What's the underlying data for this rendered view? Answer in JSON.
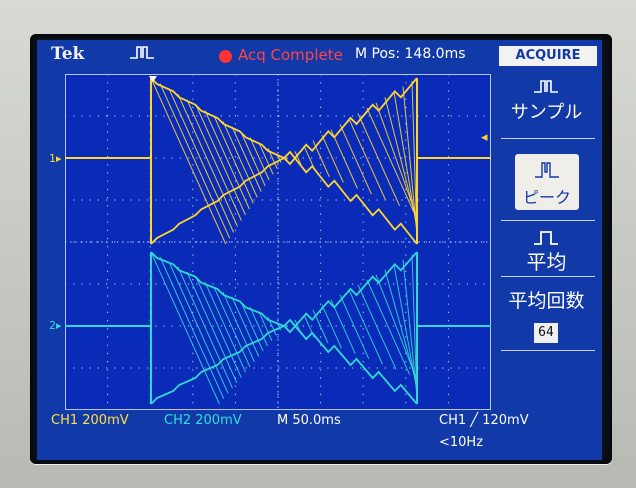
{
  "header": {
    "brand": "Tek",
    "status": "Acq Complete",
    "position": "M Pos: 148.0ms"
  },
  "menu": {
    "title": "ACQUIRE",
    "items": [
      {
        "label": "サンプル",
        "icon": "sample-mode-icon"
      },
      {
        "label": "ピーク",
        "icon": "peak-detect-icon",
        "selected": true
      },
      {
        "label": "平均",
        "icon": "average-mode-icon"
      },
      {
        "label": "平均回数",
        "value": "64"
      }
    ]
  },
  "channels": {
    "ch1_marker": "1",
    "ch2_marker": "2",
    "ch1_scale": "CH1  200mV",
    "ch2_scale": "CH2  200mV",
    "timebase": "M 50.0ms",
    "trigger": "CH1 ╱ 120mV",
    "frequency": "<10Hz"
  },
  "colors": {
    "ch1": "#ffd62e",
    "ch2": "#2fd9d2",
    "screen": "#1239a8",
    "status": "#ff4444"
  }
}
